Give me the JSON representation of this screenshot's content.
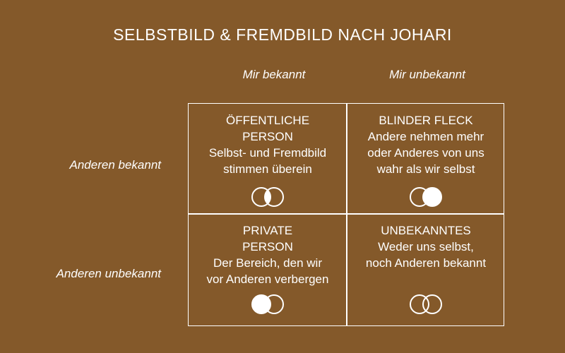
{
  "title": "SELBSTBILD & FREMDBILD NACH JOHARI",
  "columns": [
    "Mir bekannt",
    "Mir unbekannt"
  ],
  "rows": [
    "Anderen bekannt",
    "Anderen unbekannt"
  ],
  "quadrants": [
    {
      "heading_line1": "ÖFFENTLICHE",
      "heading_line2": "PERSON",
      "desc_line1": "Selbst- und Fremdbild",
      "desc_line2": "stimmen überein",
      "desc_line3": "",
      "icon": "venn-overlap-filled-icon"
    },
    {
      "heading_line1": "BLINDER FLECK",
      "heading_line2": "",
      "desc_line1": "Andere nehmen mehr",
      "desc_line2": "oder Anderes von uns",
      "desc_line3": "wahr als wir selbst",
      "icon": "venn-right-filled-icon"
    },
    {
      "heading_line1": "PRIVATE",
      "heading_line2": "PERSON",
      "desc_line1": "Der Bereich, den wir",
      "desc_line2": "vor Anderen verbergen",
      "desc_line3": "",
      "icon": "venn-left-filled-icon"
    },
    {
      "heading_line1": "UNBEKANNTES",
      "heading_line2": "",
      "desc_line1": "Weder uns selbst,",
      "desc_line2": "noch Anderen bekannt",
      "desc_line3": "",
      "icon": "venn-empty-icon"
    }
  ],
  "colors": {
    "background": "#84592a",
    "foreground": "#ffffff"
  }
}
